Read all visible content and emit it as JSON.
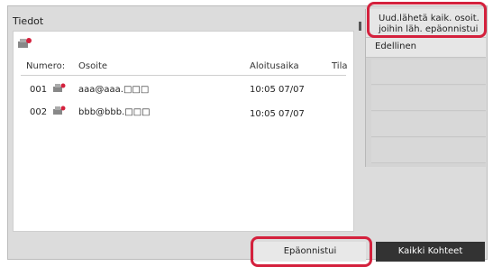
{
  "panel": {
    "title": "Tiedot",
    "columns": {
      "number": "Numero:",
      "address": "Osoite",
      "start_time": "Aloitusaika",
      "status": "Tila"
    },
    "rows": [
      {
        "number": "001",
        "address": "aaa@aaa.□□□",
        "start_time": "10:05 07/07",
        "status": ""
      },
      {
        "number": "002",
        "address": "bbb@bbb.□□□",
        "start_time": "10:05 07/07",
        "status": ""
      }
    ]
  },
  "side_menu": {
    "resend_failed_label": "Uud.lähetä kaik. osoit. joihin läh. epäonnistui",
    "previous_label": "Edellinen"
  },
  "tabs": {
    "failed_label": "Epäonnistui",
    "all_destinations_label": "Kaikki Kohteet"
  },
  "colors": {
    "highlight": "#d4213d",
    "dark_tab": "#333333",
    "background": "#dcdcdc"
  }
}
